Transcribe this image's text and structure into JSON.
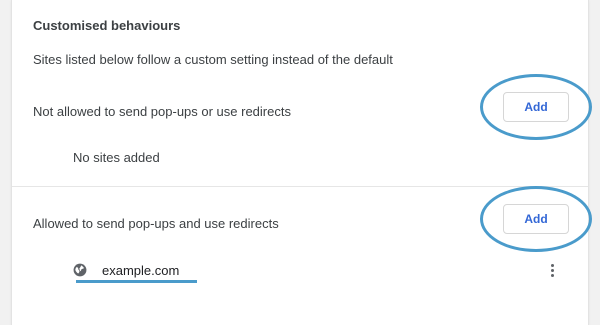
{
  "section": {
    "title": "Customised behaviours",
    "description": "Sites listed below follow a custom setting instead of the default"
  },
  "blocked": {
    "label": "Not allowed to send pop-ups or use redirects",
    "add_label": "Add",
    "empty_text": "No sites added"
  },
  "allowed": {
    "label": "Allowed to send pop-ups and use redirects",
    "add_label": "Add",
    "sites": [
      {
        "name": "example.com",
        "icon": "globe-icon"
      }
    ]
  },
  "colors": {
    "accent": "#3367d6",
    "annotation": "#4a9bcb"
  }
}
